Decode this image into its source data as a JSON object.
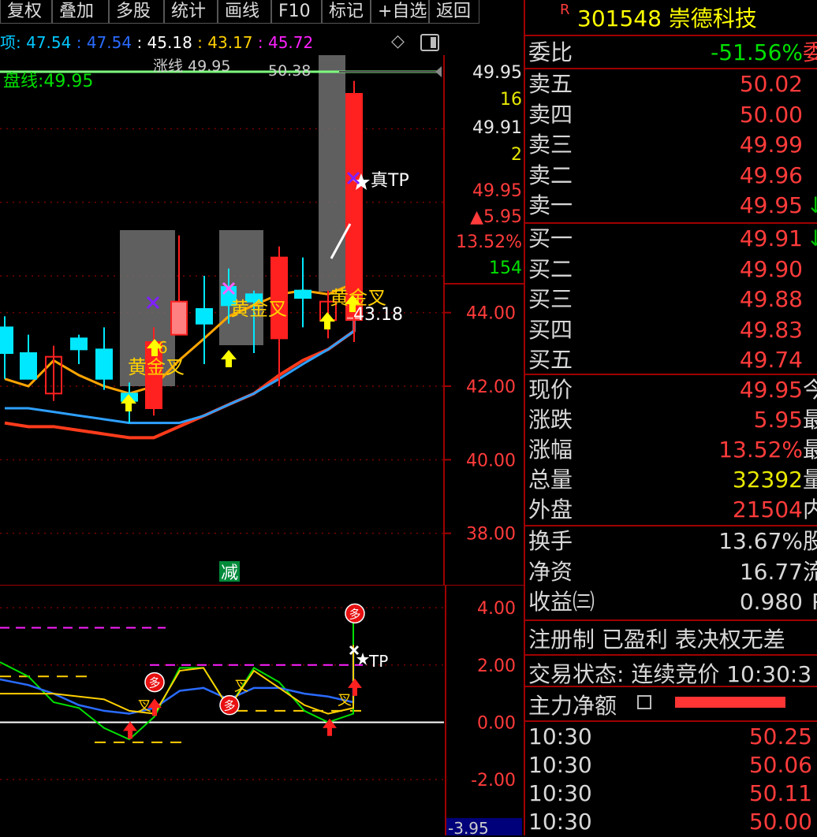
{
  "toolbar": {
    "buttons": [
      "复权",
      "叠加",
      "多股",
      "统计",
      "画线",
      "F10",
      "标记",
      "+自选",
      "返回"
    ]
  },
  "ma_legend": {
    "prefix": "项:",
    "v1": "47.54",
    "v2": ": 47.54",
    "v3": ": 45.18",
    "v4": ": 43.17",
    "v5": ": 45.72",
    "colors": [
      "#00c8ff",
      "#2a6bff",
      "#ffffff",
      "#ffd000",
      "#ff20ff"
    ]
  },
  "main_chart": {
    "pan_line_label": "盘线:49.95",
    "top_labels": [
      "涨线 49.95",
      "50.38"
    ],
    "price_axis": [
      "44.00",
      "42.00",
      "40.00",
      "38.00"
    ],
    "price_levels": [
      44.0,
      42.0,
      40.0,
      38.0
    ],
    "quote_box": {
      "p1": "49.95",
      "v1": "16",
      "p2": "49.91",
      "v2": "2",
      "p3": "49.95",
      "chg": "▲5.95",
      "pct": "13.52%",
      "vol": "154"
    },
    "annotations": {
      "tp": "真TP",
      "low": "43.18",
      "gold1": "黄金叉",
      "gold2": "黄金叉",
      "gold3": "黄金叉",
      "sign": "减",
      "num6": "6"
    }
  },
  "chart_data": [
    {
      "type": "candlestick",
      "ylabel": "",
      "ylim": [
        36.6,
        51.0
      ],
      "candles": [
        {
          "o": 43.6,
          "h": 43.9,
          "l": 42.2,
          "c": 42.9,
          "color": "cyan"
        },
        {
          "o": 42.2,
          "h": 43.4,
          "l": 42.2,
          "c": 42.9,
          "color": "cyan"
        },
        {
          "o": 42.8,
          "h": 43.1,
          "l": 41.6,
          "c": 41.8,
          "color": "red_hollow"
        },
        {
          "o": 43.0,
          "h": 43.4,
          "l": 42.6,
          "c": 43.3,
          "color": "cyan"
        },
        {
          "o": 43.0,
          "h": 43.6,
          "l": 41.9,
          "c": 42.2,
          "color": "cyan"
        },
        {
          "o": 41.6,
          "h": 42.1,
          "l": 41.0,
          "c": 41.8,
          "color": "cyan"
        },
        {
          "o": 41.4,
          "h": 43.6,
          "l": 41.2,
          "c": 43.2,
          "color": "red"
        },
        {
          "o": 44.3,
          "h": 46.1,
          "l": 43.8,
          "c": 43.4,
          "color": "red_hollow_pink"
        },
        {
          "o": 43.7,
          "h": 45.0,
          "l": 42.6,
          "c": 44.1,
          "color": "cyan"
        },
        {
          "o": 44.7,
          "h": 45.2,
          "l": 43.7,
          "c": 44.2,
          "color": "cyan_small"
        },
        {
          "o": 44.5,
          "h": 44.6,
          "l": 42.9,
          "c": 44.3,
          "color": "cyan"
        },
        {
          "o": 45.5,
          "h": 45.8,
          "l": 42.0,
          "c": 43.3,
          "color": "red"
        },
        {
          "o": 44.6,
          "h": 45.5,
          "l": 43.6,
          "c": 44.4,
          "color": "cyan"
        },
        {
          "o": 44.3,
          "h": 44.6,
          "l": 43.3,
          "c": 43.8,
          "color": "red_hollow"
        },
        {
          "o": 43.8,
          "h": 44.2,
          "l": 43.4,
          "c": 43.9,
          "color": "pink"
        },
        {
          "o": 43.9,
          "h": 50.3,
          "l": 43.2,
          "c": 49.95,
          "color": "red"
        }
      ],
      "series": [
        {
          "values": [
            42.2,
            42.0,
            42.7,
            42.3,
            42.0,
            41.8,
            42.0,
            42.7,
            43.3,
            43.9,
            44.2,
            44.5,
            44.6,
            44.5,
            44.8,
            46.8
          ],
          "color": "orange"
        },
        {
          "values": [
            41.0,
            40.9,
            40.9,
            40.8,
            40.7,
            40.6,
            40.6,
            40.9,
            41.2,
            41.5,
            41.8,
            42.3,
            42.7,
            43.0,
            43.5,
            44.0
          ],
          "color": "#ff3b1b"
        },
        {
          "values": [
            41.4,
            41.4,
            41.3,
            41.2,
            41.1,
            41.0,
            41.0,
            41.0,
            41.2,
            41.5,
            41.8,
            42.2,
            42.6,
            43.0,
            43.5,
            44.0
          ],
          "color": "#2ea0ff"
        }
      ]
    },
    {
      "type": "line",
      "ylabel": "",
      "ylim": [
        -3.95,
        4.8
      ],
      "yticks": [
        "4.00",
        "2.00",
        "0.00",
        "-2.00"
      ],
      "tick_values": [
        4,
        2,
        0,
        -2
      ],
      "bottom_value": "-3.95",
      "series": [
        {
          "values": [
            2.1,
            1.6,
            0.7,
            0.5,
            -0.2,
            -0.6,
            0.2,
            1.9,
            1.9,
            0.5,
            1.9,
            1.4,
            0.4,
            0.0,
            0.3,
            4.0
          ],
          "color": "#00e000"
        },
        {
          "values": [
            1.5,
            1.3,
            1.0,
            0.6,
            0.4,
            0.3,
            0.5,
            1.1,
            1.2,
            0.8,
            1.2,
            1.2,
            1.0,
            0.9,
            0.7,
            2.4
          ],
          "color": "#2a6bff"
        },
        {
          "values": [
            1.0,
            1.0,
            1.0,
            0.9,
            0.8,
            0.4,
            0.3,
            1.8,
            1.9,
            0.5,
            1.8,
            1.2,
            0.6,
            0.3,
            0.5,
            2.7
          ],
          "color": "#ffd000"
        }
      ],
      "labels": {
        "tp": "TP",
        "duo": "多",
        "cha": "叉"
      }
    }
  ],
  "right_panel": {
    "code_prefix": "R",
    "title": "301548 崇德科技",
    "weibi_label": "委比",
    "weibi_value": "-51.56%",
    "weibi_tail": "委",
    "asks": [
      {
        "label": "卖五",
        "price": "50.02"
      },
      {
        "label": "卖四",
        "price": "50.00"
      },
      {
        "label": "卖三",
        "price": "49.99"
      },
      {
        "label": "卖二",
        "price": "49.96"
      },
      {
        "label": "卖一",
        "price": "49.95",
        "arrow": "↓"
      }
    ],
    "bids": [
      {
        "label": "买一",
        "price": "49.91",
        "arrow": "↓"
      },
      {
        "label": "买二",
        "price": "49.90"
      },
      {
        "label": "买三",
        "price": "49.88"
      },
      {
        "label": "买四",
        "price": "49.83"
      },
      {
        "label": "买五",
        "price": "49.74"
      }
    ],
    "stats": [
      {
        "label": "现价",
        "value": "49.95",
        "color": "#ff3b3b",
        "tail": "今"
      },
      {
        "label": "涨跌",
        "value": "5.95",
        "color": "#ff3b3b",
        "tail": "最"
      },
      {
        "label": "涨幅",
        "value": "13.52%",
        "color": "#ff3b3b",
        "tail": "最"
      },
      {
        "label": "总量",
        "value": "32392",
        "color": "#e8e800",
        "tail": "量"
      },
      {
        "label": "外盘",
        "value": "21504",
        "color": "#ff3b3b",
        "tail": "内"
      }
    ],
    "stats2": [
      {
        "label": "换手",
        "value": "13.67%",
        "tail": "股"
      },
      {
        "label": "净资",
        "value": "16.77",
        "tail": "流"
      },
      {
        "label": "收益㈢",
        "value": "0.980",
        "tail": "P"
      }
    ],
    "reg_text": "注册制 已盈利 表决权无差",
    "trade_status": "交易状态: 连续竞价 10:30:3",
    "main_net_label": "主力净额",
    "ticks": [
      {
        "time": "10:30",
        "price": "50.25"
      },
      {
        "time": "10:30",
        "price": "50.06"
      },
      {
        "time": "10:30",
        "price": "50.11"
      },
      {
        "time": "10:30",
        "price": "50.00"
      }
    ]
  }
}
